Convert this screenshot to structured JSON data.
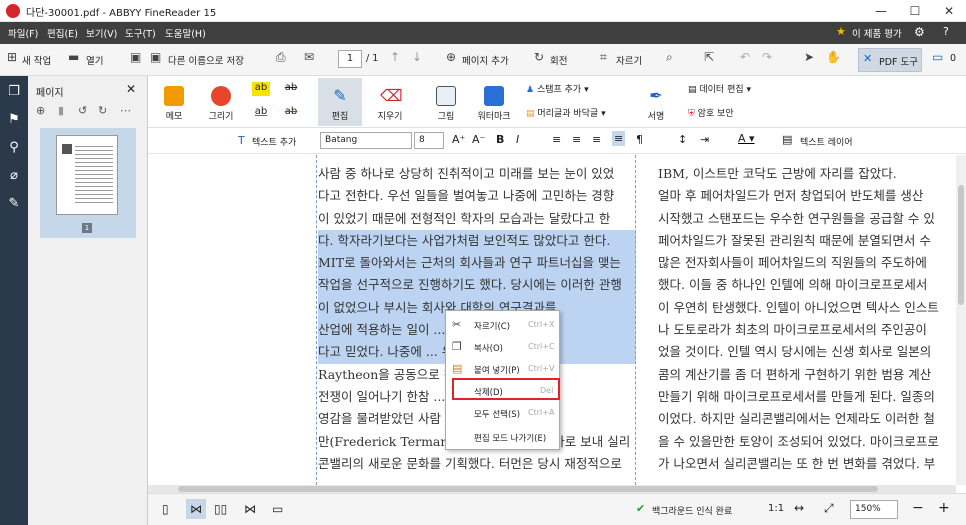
{
  "window": {
    "title": "다단-30001.pdf - ABBYY FineReader 15",
    "minimize": "—",
    "maximize": "☐",
    "close": "✕"
  },
  "menu": {
    "items": [
      "파일(F)",
      "편집(E)",
      "보기(V)",
      "도구(T)",
      "도움말(H)"
    ],
    "promo": "이 제품 평가"
  },
  "toolbar": {
    "new_label": "새 작업",
    "open_label": "열기",
    "saveas_label": "다른 이름으로 저장",
    "page_value": "1",
    "page_total": "/ 1",
    "addpage_label": "페이지 추가",
    "rotate_label": "회전",
    "crop_label": "자르기",
    "pdftool_label": "PDF 도구",
    "comments_count": "0"
  },
  "panel": {
    "title": "페이지",
    "thumb_number": "1"
  },
  "ribbon": {
    "memo": "메모",
    "draw": "그리기",
    "edit": "편집",
    "erase": "지우기",
    "picture": "그림",
    "watermark": "워터마크",
    "stamp_add": "스탬프 추가",
    "header_footer": "머리글과 바닥글",
    "signature": "서명",
    "data_edit": "데이터 편집",
    "password": "암호 보안",
    "ab": "ab"
  },
  "format": {
    "add_text": "텍스트 추가",
    "font": "Batang",
    "size": "8",
    "text_layer": "텍스트 레이어"
  },
  "document": {
    "left_col": [
      "사람 중 하나로 상당히 진취적이고 미래를 보는 눈이 있었",
      "다고 전한다. 우선 일들을 벌여놓고 나중에 고민하는 경향",
      "이 있었기 때문에 전형적인 학자의 모습과는 달랐다고 한",
      "다. 학자라기보다는 사업가처럼 보인적도 많았다고 한다.",
      "MIT로 돌아와서는 근처의 회사들과 연구 파트너십을 맺는",
      "작업을 선구적으로 진행하기도 했다. 당시에는 이러한 관행",
      "이 없었으나 부시는 회사와 대학의 연구결과를",
      "산업에 적용하는 일이 ... 이 반드시 필요하",
      "다고 믿었다. 나중에 ... 유명 방위산업체인",
      "Raytheon을 공동으로 창...",
      "전쟁이 일어나기 한참 ... 부시는 자신의",
      "영감을 물려받았던 사람 ... 프레더릭 터",
      "만(Frederick Terman)을 격려해 캘리포니아로 보내 실리",
      "콘밸리의 새로운 문화를 기획했다. 터먼은 당시 재정적으로"
    ],
    "right_col": [
      "IBM, 이스트만 코닥도 근방에 자리를 잡았다.",
      "얼마 후 페어차일드가 먼저 창업되어 반도체를 생산",
      "시작했고 스탠포드는 우수한 연구원들을 공급할 수 있",
      "페어차일드가 잘못된 관리원칙 때문에 분열되면서 수",
      "많은 전자회사들이 페어차일드의 직원들의 주도하에",
      "했다. 이들 중 하나인 인텔에 의해 마이크로프로세서",
      "이 우연히 탄생했다. 인텔이 아니었으면 텍사스 인스트",
      "나 도토로라가 최초의 마이크로프로세서의 주인공이",
      "었을 것이다. 인텔 역시 당시에는 신생 회사로 일본의",
      "콤의 계산기를 좀 더 편하게 구현하기 위한 범용 계산",
      "만들기 위해 마이크로프로세서를 만들게 된다. 일종의",
      "이었다. 하지만 실리콘밸리에서는 언제라도 이러한 철",
      "을 수 있을만한 토양이 조성되어 있었다. 마이크로프로",
      "가 나오면서 실리콘밸리는 또 한 번 변화를 겪었다. 부"
    ]
  },
  "context_menu": [
    {
      "label": "자르기(C)",
      "shortcut": "Ctrl+X",
      "icon": "scissors-icon"
    },
    {
      "label": "복사(O)",
      "shortcut": "Ctrl+C",
      "icon": "copy-icon"
    },
    {
      "label": "붙여 넣기(P)",
      "shortcut": "Ctrl+V",
      "icon": "paste-icon"
    },
    {
      "label": "삭제(D)",
      "shortcut": "Del",
      "icon": ""
    },
    {
      "label": "모두 선택(S)",
      "shortcut": "Ctrl+A",
      "icon": ""
    },
    {
      "label": "편집 모드 나가기(E)",
      "shortcut": "",
      "icon": ""
    }
  ],
  "status": {
    "bg_recognition": "백그라운드 인식 완료",
    "ratio": "1:1",
    "zoom": "150%"
  },
  "colors": {
    "accent_red": "#e0232b",
    "nav_dark": "#2b3a4a",
    "menu_dark": "#3f3f3f",
    "selection": "#bcd4f2"
  }
}
